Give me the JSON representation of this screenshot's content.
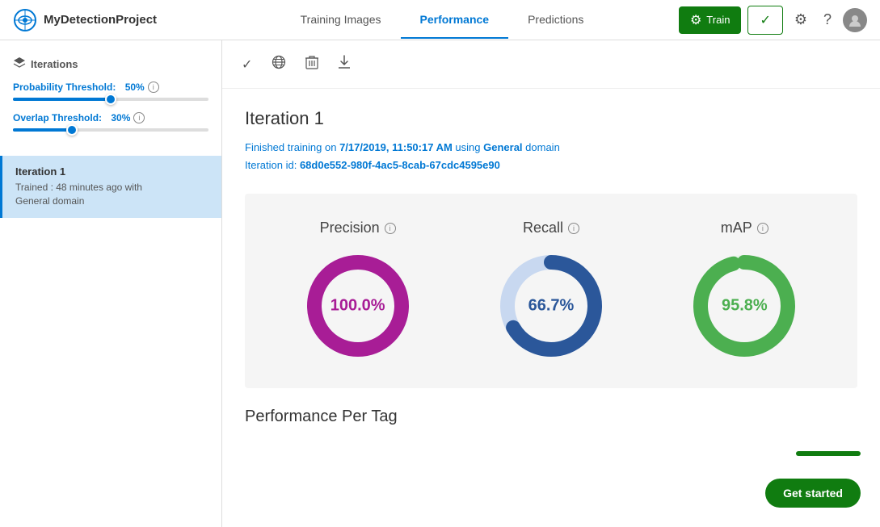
{
  "header": {
    "project_name": "MyDetectionProject",
    "tabs": [
      {
        "id": "training-images",
        "label": "Training Images",
        "active": false
      },
      {
        "id": "performance",
        "label": "Performance",
        "active": true
      },
      {
        "id": "predictions",
        "label": "Predictions",
        "active": false
      }
    ],
    "btn_train_label": "Train",
    "btn_check_label": "✓",
    "settings_icon": "⚙",
    "help_icon": "?",
    "avatar_icon": "👤"
  },
  "sidebar": {
    "section_title": "Iterations",
    "probability_threshold_label": "Probability Threshold:",
    "probability_threshold_value": "50%",
    "overlap_threshold_label": "Overlap Threshold:",
    "overlap_threshold_value": "30%",
    "probability_fill_pct": 50,
    "overlap_fill_pct": 30,
    "iteration": {
      "title": "Iteration 1",
      "desc_line1": "Trained : 48 minutes ago with",
      "desc_line2": "General domain"
    }
  },
  "toolbar": {
    "check_icon": "✓",
    "globe_icon": "🌐",
    "delete_icon": "🗑",
    "download_icon": "⬇"
  },
  "content": {
    "iteration_title": "Iteration 1",
    "meta_line1_prefix": "Finished training on ",
    "meta_date": "7/17/2019, 11:50:17 AM",
    "meta_line1_suffix": " using ",
    "meta_domain": "General",
    "meta_domain_suffix": " domain",
    "meta_line2_prefix": "Iteration id: ",
    "meta_iteration_id": "68d0e552-980f-4ac5-8cab-67cdc4595e90",
    "metrics": [
      {
        "id": "precision",
        "label": "Precision",
        "value": "100.0%",
        "percentage": 100,
        "color": "#a81d96",
        "bg_color": "#e8d0e6"
      },
      {
        "id": "recall",
        "label": "Recall",
        "value": "66.7%",
        "percentage": 66.7,
        "color": "#2b579a",
        "bg_color": "#c8d8f0"
      },
      {
        "id": "map",
        "label": "mAP",
        "value": "95.8%",
        "percentage": 95.8,
        "color": "#4caf50",
        "bg_color": "#c8e6c9"
      }
    ],
    "performance_per_tag_title": "Performance Per Tag",
    "get_started_label": "Get started"
  }
}
